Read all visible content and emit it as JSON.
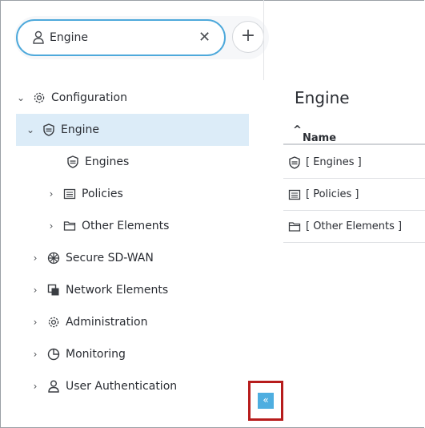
{
  "tab": {
    "label": "Engine",
    "close": "✕",
    "add": "+"
  },
  "tree": [
    {
      "label": "Configuration",
      "icon": "gear-icon",
      "expanded": true
    },
    {
      "label": "Engine",
      "icon": "engine-shield-icon",
      "expanded": true,
      "selected": true
    },
    {
      "label": "Engines",
      "icon": "engine-shield-icon"
    },
    {
      "label": "Policies",
      "icon": "policies-icon",
      "expanded": false
    },
    {
      "label": "Other Elements",
      "icon": "folder-icon",
      "expanded": false
    },
    {
      "label": "Secure SD-WAN",
      "icon": "sdwan-icon",
      "expanded": false
    },
    {
      "label": "Network Elements",
      "icon": "network-elements-icon",
      "expanded": false
    },
    {
      "label": "Administration",
      "icon": "gear-icon",
      "expanded": false
    },
    {
      "label": "Monitoring",
      "icon": "monitoring-icon",
      "expanded": false
    },
    {
      "label": "User Authentication",
      "icon": "user-icon",
      "expanded": false
    }
  ],
  "panel": {
    "title": "Engine",
    "column_header": "Name",
    "sort_indicator": "^",
    "rows": [
      {
        "label": "[ Engines ]",
        "icon": "engine-shield-icon"
      },
      {
        "label": "[ Policies ]",
        "icon": "policies-icon"
      },
      {
        "label": "[ Other Elements ]",
        "icon": "folder-icon"
      }
    ]
  },
  "collapse_button": {
    "label": "«"
  },
  "colors": {
    "accent": "#4ea9db",
    "selected_row": "#dcecf8",
    "highlight_box": "#b71c1c"
  }
}
